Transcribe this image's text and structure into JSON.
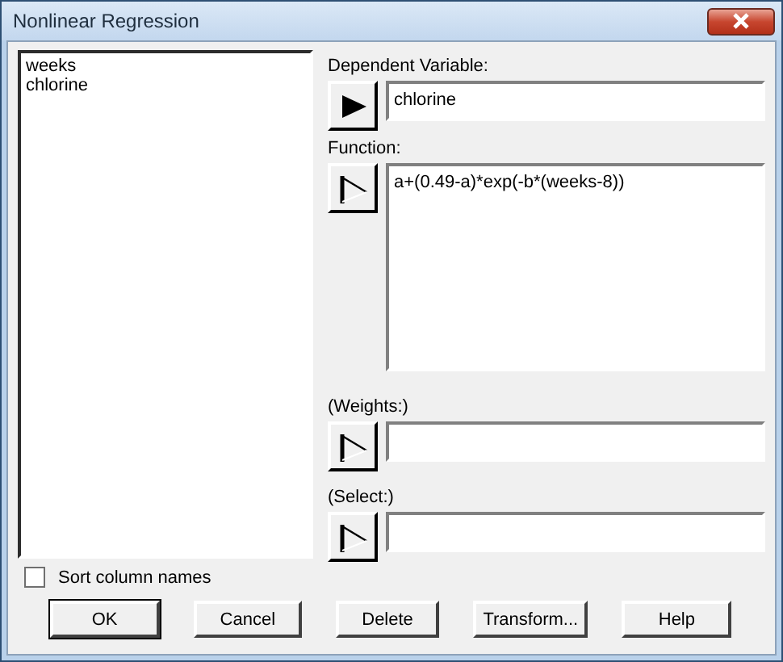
{
  "window": {
    "title": "Nonlinear Regression"
  },
  "column_list": {
    "items": [
      {
        "label": "weeks",
        "selected": false
      },
      {
        "label": "chlorine",
        "selected": false
      }
    ]
  },
  "fields": [
    {
      "kind": "line",
      "label": "Dependent Variable:",
      "value": "chlorine",
      "active": true
    },
    {
      "kind": "area",
      "label": "Function:",
      "value": "a+(0.49-a)*exp(-b*(weeks-8))",
      "active": false
    },
    {
      "kind": "line",
      "label": "(Weights:)",
      "active": false
    },
    {
      "kind": "line",
      "label": "(Select:)",
      "active": false
    }
  ],
  "sort_checkbox": {
    "label": "Sort column names",
    "checked": false
  },
  "buttons": [
    {
      "label": "OK",
      "default": true
    },
    {
      "label": "Cancel",
      "default": false
    },
    {
      "label": "Delete",
      "default": false
    },
    {
      "label": "Transform...",
      "default": false
    },
    {
      "label": "Help",
      "default": false
    }
  ]
}
